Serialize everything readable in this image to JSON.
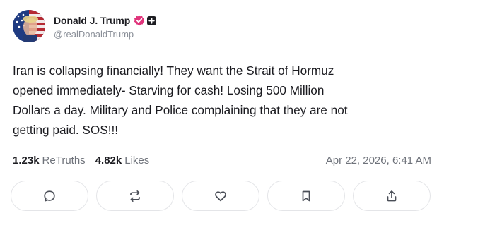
{
  "post": {
    "author": {
      "display_name": "Donald J. Trump",
      "handle": "@realDonaldTrump",
      "verified_badge_color": "#e0347b"
    },
    "text": "Iran is collapsing financially! They want the Strait of Hormuz\nopened immediately- Starving for cash! Losing 500 Million\nDollars a day. Military and Police complaining that they are not\ngetting paid. SOS!!!",
    "stats": {
      "retruths_count": "1.23k",
      "retruths_label": "ReTruths",
      "likes_count": "4.82k",
      "likes_label": "Likes",
      "timestamp": "Apr 22, 2026, 6:41 AM"
    },
    "actions": [
      {
        "icon": "comment-icon"
      },
      {
        "icon": "retruth-icon"
      },
      {
        "icon": "heart-icon"
      },
      {
        "icon": "bookmark-icon"
      },
      {
        "icon": "share-icon"
      }
    ]
  }
}
